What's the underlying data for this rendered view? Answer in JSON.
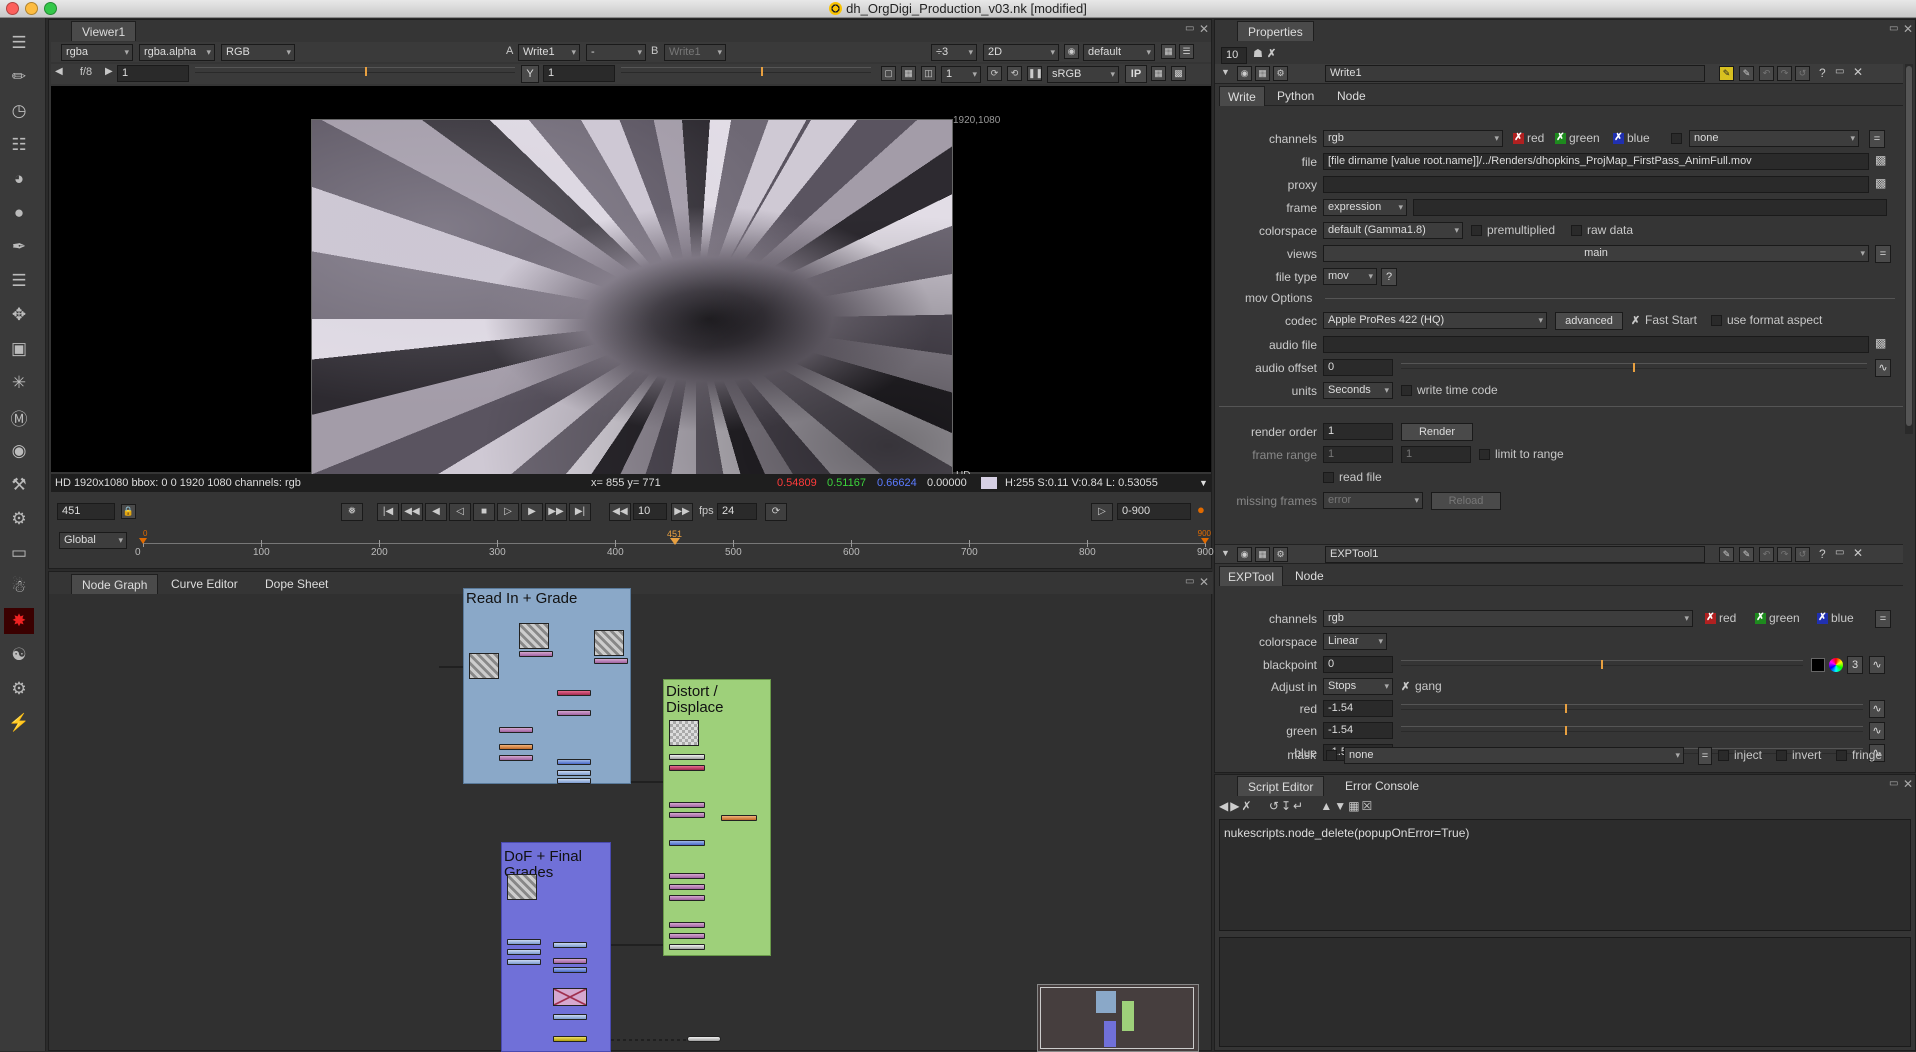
{
  "window": {
    "title": "dh_OrgDigi_Production_v03.nk [modified]"
  },
  "viewer": {
    "tab": "Viewer1",
    "channels": "rgba",
    "alpha": "rgba.alpha",
    "display": "RGB",
    "a_label": "A",
    "a_input": "Write1",
    "op": "-",
    "b_label": "B",
    "b_input": "Write1",
    "downrez": "÷3",
    "mode": "2D",
    "lut": "default",
    "fstop": "f/8",
    "gain": "1",
    "y_label": "Y",
    "gamma": "1",
    "proxy": "1",
    "colorspace": "sRGB",
    "ip": "IP",
    "format_label": "1920,1080",
    "hd_label": "HD",
    "info": {
      "format": "HD 1920x1080 bbox: 0 0 1920 1080 channels: rgb",
      "coords": "x= 855 y= 771",
      "r": "0.54809",
      "g": "0.51167",
      "b": "0.66624",
      "a": "0.00000",
      "hsvl": "H:255 S:0.11 V:0.84  L: 0.53055"
    }
  },
  "timeline": {
    "frame": "451",
    "global": "Global",
    "step": "10",
    "fps_label": "fps",
    "fps": "24",
    "range": "0-900",
    "ticks": [
      "0",
      "100",
      "200",
      "300",
      "400",
      "500",
      "600",
      "700",
      "800",
      "900"
    ],
    "start_marker": "0",
    "current_marker": "451",
    "end_marker": "900",
    "current_fraction": 0.501
  },
  "nodegraph": {
    "tabs": [
      "Node Graph",
      "Curve Editor",
      "Dope Sheet"
    ],
    "backdrops": [
      {
        "title": "Read In + Grade"
      },
      {
        "title": "Distort / Displace"
      },
      {
        "title": "DoF + Final Grades"
      }
    ]
  },
  "properties": {
    "tab": "Properties",
    "max_panels": "10",
    "write": {
      "name": "Write1",
      "tabs": [
        "Write",
        "Python",
        "Node"
      ],
      "channels_label": "channels",
      "channels": "rgb",
      "red": "red",
      "green": "green",
      "blue": "blue",
      "alpha_value": "none",
      "file_label": "file",
      "file": "[file dirname [value root.name]]/../Renders/dhopkins_ProjMap_FirstPass_AnimFull.mov",
      "proxy_label": "proxy",
      "frame_label": "frame",
      "frame": "expression",
      "colorspace_label": "colorspace",
      "colorspace": "default (Gamma1.8)",
      "premultiplied": "premultiplied",
      "raw_data": "raw data",
      "views_label": "views",
      "views": "main",
      "filetype_label": "file type",
      "filetype": "mov",
      "help": "?",
      "mov_options": "mov Options",
      "codec_label": "codec",
      "codec": "Apple ProRes 422 (HQ)",
      "advanced": "advanced",
      "fast_start": "Fast Start",
      "use_format_aspect": "use format aspect",
      "audio_file_label": "audio file",
      "audio_offset_label": "audio offset",
      "audio_offset": "0",
      "units_label": "units",
      "units": "Seconds",
      "write_time_code": "write time code",
      "render_order_label": "render order",
      "render_order": "1",
      "render": "Render",
      "frame_range_label": "frame range",
      "frame_range_start": "1",
      "frame_range_end": "1",
      "limit_to_range": "limit to range",
      "read_file": "read file",
      "missing_frames_label": "missing frames",
      "missing_frames": "error",
      "reload": "Reload"
    },
    "exptool": {
      "name": "EXPTool1",
      "tabs": [
        "EXPTool",
        "Node"
      ],
      "channels_label": "channels",
      "channels": "rgb",
      "red": "red",
      "green": "green",
      "blue": "blue",
      "colorspace_label": "colorspace",
      "colorspace": "Linear",
      "blackpoint_label": "blackpoint",
      "blackpoint": "0",
      "blackpoint_channels": "3",
      "adjust_label": "Adjust in",
      "adjust": "Stops",
      "gang": "gang",
      "red_label": "red",
      "red_value": "-1.54",
      "green_label": "green",
      "green_value": "-1.54",
      "blue_label": "blue",
      "blue_value": "-1.54",
      "mask_label": "mask",
      "mask": "none",
      "inject": "inject",
      "invert": "invert",
      "fringe": "fringe"
    }
  },
  "script_editor": {
    "tabs": [
      "Script Editor",
      "Error Console"
    ],
    "output": "nukescripts.node_delete(popupOnError=True)"
  },
  "colors": {
    "accent_orange": "#e06a00",
    "red": "#ff3b3b",
    "green": "#3cd33c",
    "blue": "#3b5bff"
  },
  "icons": [
    "menu-icon",
    "brush-icon",
    "clock-icon",
    "channels-icon",
    "color-wheel-icon",
    "circle-filter-icon",
    "keyer-icon",
    "merge-layers-icon",
    "transform-icon",
    "3d-cube-icon",
    "particles-icon",
    "deep-icon",
    "views-icon",
    "metadata-icon",
    "toolsets-icon",
    "other-icon",
    "furnace-icon",
    "ocula-icon",
    "nodes-icon",
    "plugin-icon"
  ]
}
